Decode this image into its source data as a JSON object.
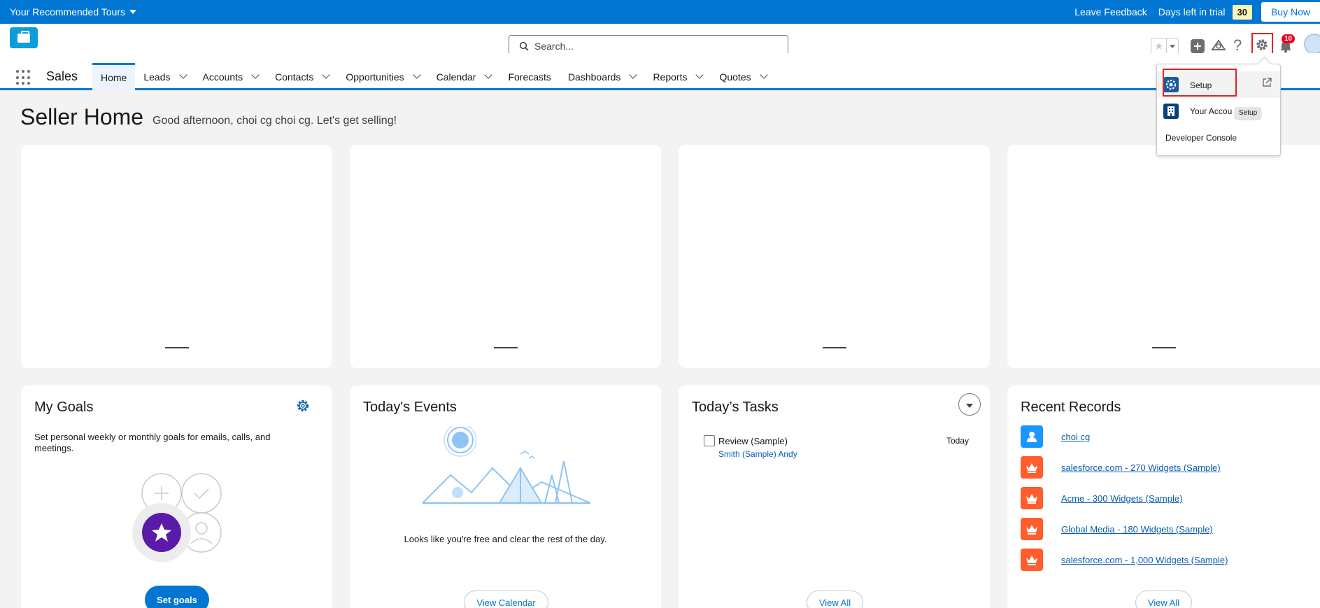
{
  "banner": {
    "tours_label": "Your Recommended Tours",
    "feedback_label": "Leave Feedback",
    "days_label": "Days left in trial",
    "days_count": "30",
    "buy_label": "Buy Now"
  },
  "header": {
    "search_placeholder": "Search...",
    "notification_count": "10"
  },
  "nav": {
    "app_name": "Sales",
    "items": [
      {
        "label": "Home",
        "active": true,
        "dropdown": false
      },
      {
        "label": "Leads",
        "dropdown": true
      },
      {
        "label": "Accounts",
        "dropdown": true
      },
      {
        "label": "Contacts",
        "dropdown": true
      },
      {
        "label": "Opportunities",
        "dropdown": true
      },
      {
        "label": "Calendar",
        "dropdown": true
      },
      {
        "label": "Forecasts",
        "dropdown": false
      },
      {
        "label": "Dashboards",
        "dropdown": true
      },
      {
        "label": "Reports",
        "dropdown": true
      },
      {
        "label": "Quotes",
        "dropdown": true
      }
    ]
  },
  "page": {
    "title": "Seller Home",
    "greeting": "Good afternoon, choi cg choi cg. Let's get selling!"
  },
  "goals": {
    "title": "My Goals",
    "description": "Set personal weekly or monthly goals for emails, calls, and meetings.",
    "button": "Set goals"
  },
  "events": {
    "title": "Today's Events",
    "message": "Looks like you're free and clear the rest of the day.",
    "button": "View Calendar"
  },
  "tasks": {
    "title": "Today’s Tasks",
    "items": [
      {
        "name": "Review (Sample)",
        "date": "Today",
        "related": "Smith (Sample) Andy"
      }
    ],
    "button": "View All"
  },
  "recent": {
    "title": "Recent Records",
    "items": [
      {
        "label": "choi cg",
        "type": "user"
      },
      {
        "label": "salesforce.com - 270 Widgets (Sample)",
        "type": "opportunity"
      },
      {
        "label": "Acme - 300 Widgets (Sample)",
        "type": "opportunity"
      },
      {
        "label": "Global Media - 180 Widgets (Sample)",
        "type": "opportunity"
      },
      {
        "label": "salesforce.com - 1,000 Widgets (Sample)",
        "type": "opportunity"
      }
    ],
    "button": "View All"
  },
  "setup_menu": {
    "setup_label": "Setup",
    "account_label": "Your Accou",
    "dev_console_label": "Developer Console",
    "tooltip": "Setup"
  },
  "colors": {
    "brand": "#0176d3",
    "opportunity": "#ff5d2d",
    "user": "#1b96ff",
    "highlight": "#e32222"
  }
}
